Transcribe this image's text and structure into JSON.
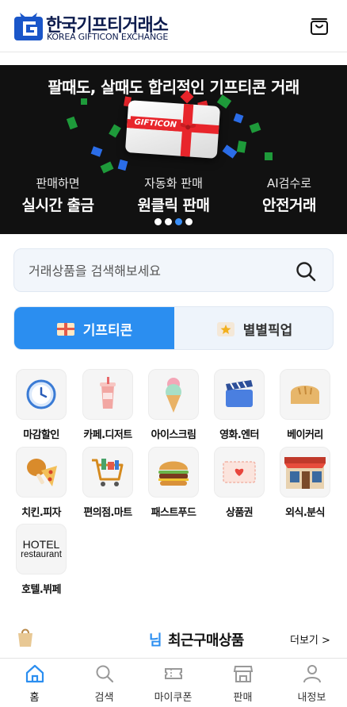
{
  "header": {
    "logo_title": "한국기프티거래소",
    "logo_sub": "KOREA GIFTICON EXCHANGE",
    "cart_icon": "cart-icon"
  },
  "banner": {
    "title": "팔때도, 살때도 합리적인 기프티콘 거래",
    "card_label": "GIFTICON",
    "features": [
      {
        "sub": "판매하면",
        "main": "실시간 출금"
      },
      {
        "sub": "자동화 판매",
        "main": "원클릭 판매"
      },
      {
        "sub": "AI검수로",
        "main": "안전거래"
      }
    ],
    "slide_count": 4,
    "active_slide": 3
  },
  "search": {
    "placeholder": "거래상품을 검색해보세요",
    "value": ""
  },
  "tabs": [
    {
      "label": "기프티콘",
      "active": true,
      "icon": "gift-icon"
    },
    {
      "label": "별별픽업",
      "active": false,
      "icon": "star-icon"
    }
  ],
  "categories": [
    {
      "label": "마감할인",
      "icon": "clock-icon"
    },
    {
      "label": "카페.디저트",
      "icon": "coffee-cup-icon"
    },
    {
      "label": "아이스크림",
      "icon": "ice-cream-icon"
    },
    {
      "label": "영화.엔터",
      "icon": "clapperboard-icon"
    },
    {
      "label": "베이커리",
      "icon": "bread-icon"
    },
    {
      "label": "치킨.피자",
      "icon": "chicken-pizza-icon"
    },
    {
      "label": "편의점.마트",
      "icon": "shopping-cart-icon"
    },
    {
      "label": "패스트푸드",
      "icon": "burger-icon"
    },
    {
      "label": "상품권",
      "icon": "voucher-icon"
    },
    {
      "label": "외식.분식",
      "icon": "restaurant-icon"
    },
    {
      "label": "호텔.뷔페",
      "icon": "hotel-icon",
      "image_text": [
        "HOTEL",
        "restaurant"
      ]
    }
  ],
  "recent": {
    "user_suffix": "님",
    "title": "최근구매상품",
    "more_label": "더보기 >"
  },
  "bottom_nav": [
    {
      "label": "홈",
      "icon": "home-icon",
      "active": true
    },
    {
      "label": "검색",
      "icon": "search-icon",
      "active": false
    },
    {
      "label": "마이쿠폰",
      "icon": "ticket-icon",
      "active": false
    },
    {
      "label": "판매",
      "icon": "store-icon",
      "active": false
    },
    {
      "label": "내정보",
      "icon": "user-icon",
      "active": false
    }
  ],
  "colors": {
    "brand_navy": "#0c1b4d",
    "accent_blue": "#2b8ef0",
    "banner_bg": "#111111",
    "ribbon_red": "#e8252b"
  }
}
